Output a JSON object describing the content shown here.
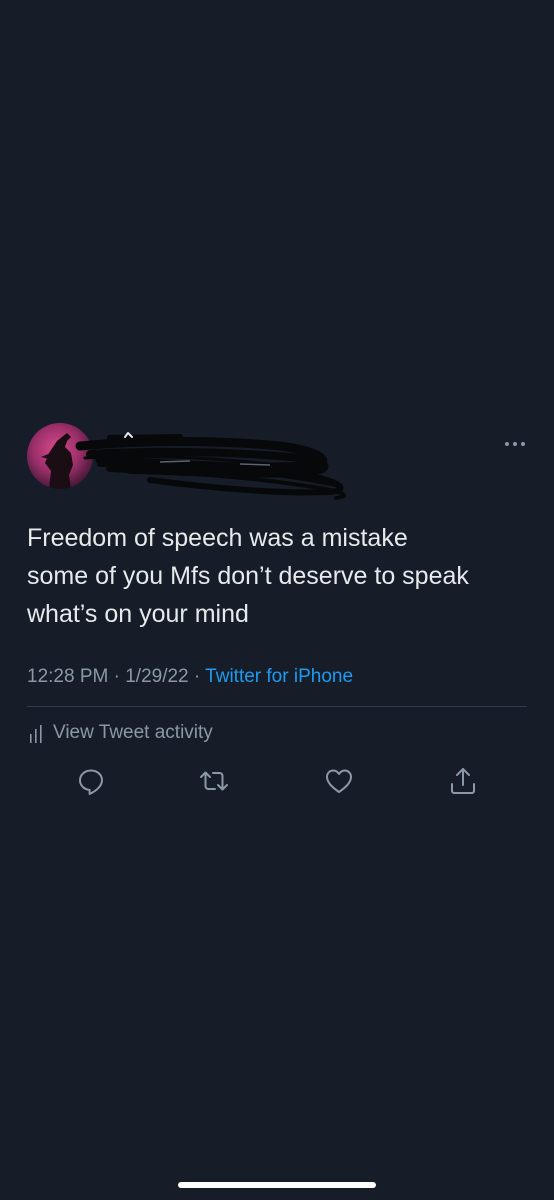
{
  "tweet": {
    "text_lines": [
      "Freedom of speech was a mistake",
      "some of you Mfs don’t deserve to speak",
      "what’s on your mind"
    ],
    "time": "12:28 PM",
    "separator": " · ",
    "date": "1/29/22",
    "source": "Twitter for iPhone"
  },
  "activity": {
    "label": "View Tweet activity",
    "icon": "bar-chart-icon"
  },
  "actions": [
    {
      "name": "reply",
      "icon": "reply-icon"
    },
    {
      "name": "retweet",
      "icon": "retweet-icon"
    },
    {
      "name": "like",
      "icon": "heart-icon"
    },
    {
      "name": "share",
      "icon": "share-icon"
    }
  ],
  "colors": {
    "background": "#161d29",
    "text": "#e7e9ea",
    "secondary": "#8b98a5",
    "link": "#1d9bf0",
    "divider": "#2f3b48"
  }
}
